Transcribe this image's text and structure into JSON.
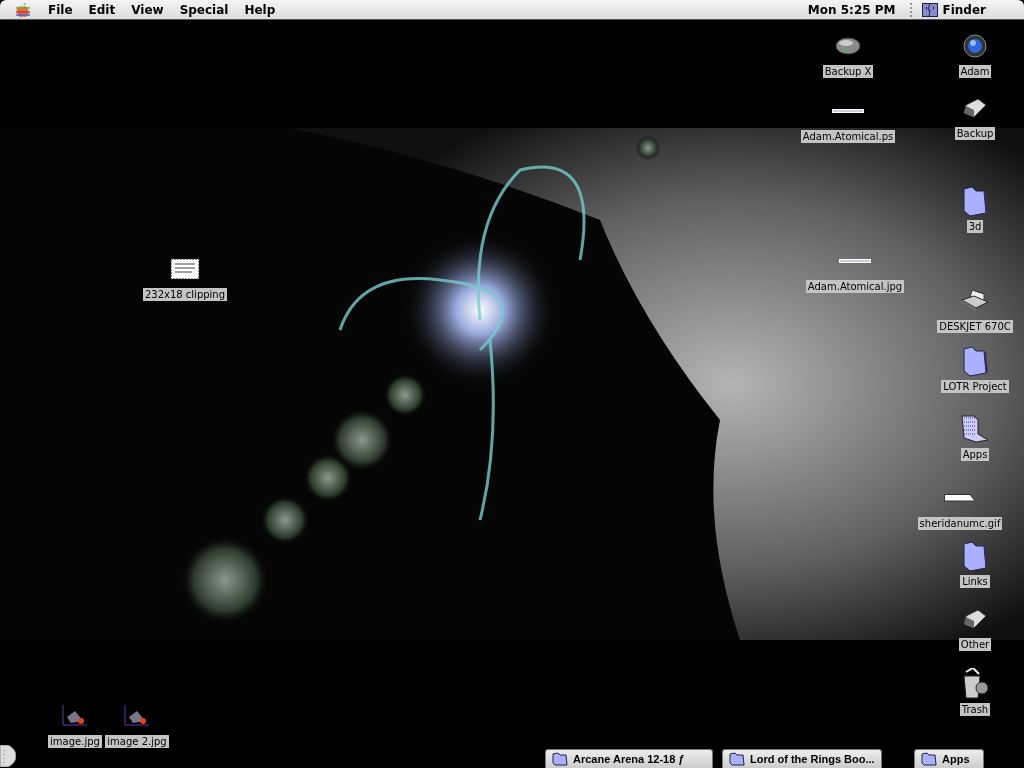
{
  "menu_bar": {
    "menus": [
      "File",
      "Edit",
      "View",
      "Special",
      "Help"
    ],
    "clock": "Mon 5:25 PM",
    "application": "Finder"
  },
  "desktop_icons": [
    {
      "label": "Backup X",
      "kind": "disk"
    },
    {
      "label": "Adam",
      "kind": "computer"
    },
    {
      "label": "Adam.Atomical.ps",
      "kind": "strip"
    },
    {
      "label": "Backup",
      "kind": "drive"
    },
    {
      "label": "3d",
      "kind": "folder"
    },
    {
      "label": "Adam.Atomical.jpg",
      "kind": "strip"
    },
    {
      "label": "DESKJET 670C",
      "kind": "printer"
    },
    {
      "label": "LOTR Project",
      "kind": "folder"
    },
    {
      "label": "Apps",
      "kind": "shared"
    },
    {
      "label": "sheridanumc.gif",
      "kind": "document"
    },
    {
      "label": "Links",
      "kind": "folder"
    },
    {
      "label": "Other",
      "kind": "drive"
    },
    {
      "label": "Trash",
      "kind": "trash"
    },
    {
      "label": "232x18 clipping",
      "kind": "clipping"
    },
    {
      "label": "image.jpg",
      "kind": "image"
    },
    {
      "label": "image 2.jpg",
      "kind": "image"
    }
  ],
  "window_tabs": [
    {
      "label": "Arcane Arena 12-18 ƒ"
    },
    {
      "label": "Lord of the Rings Boo..."
    },
    {
      "label": "Apps"
    }
  ]
}
